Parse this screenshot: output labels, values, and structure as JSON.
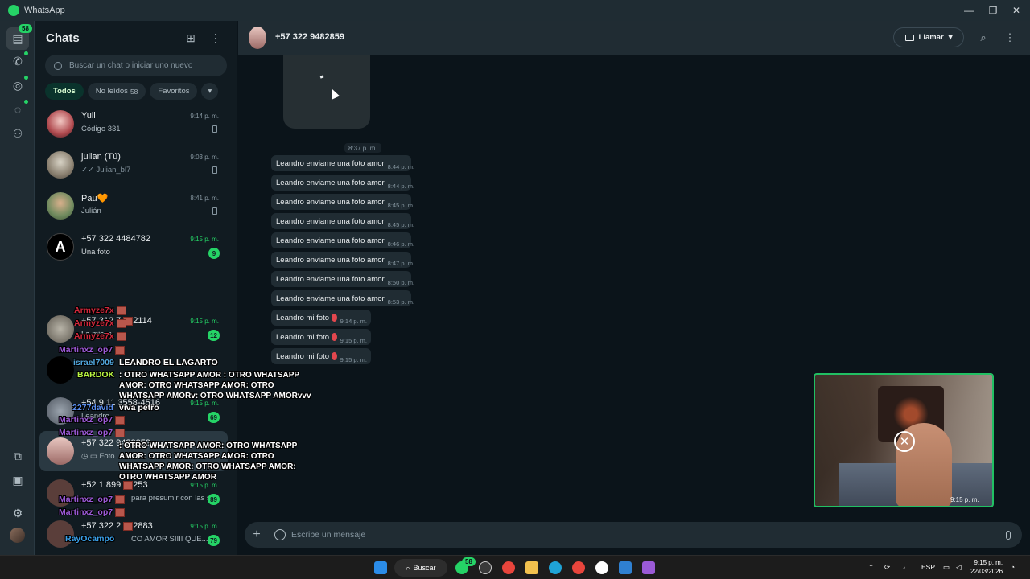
{
  "app": {
    "title": "WhatsApp"
  },
  "rail": {
    "chats_badge": "58"
  },
  "panel": {
    "title": "Chats",
    "search_placeholder": "Buscar un chat o iniciar uno nuevo",
    "filters": [
      {
        "label": "Todos",
        "count": ""
      },
      {
        "label": "No leídos",
        "count": "58"
      },
      {
        "label": "Favoritos",
        "count": ""
      }
    ],
    "filters_more": "▾"
  },
  "chats": [
    {
      "name": "Yuli",
      "preview": "Código 331",
      "time": "9:14 p. m.",
      "pinned": true
    },
    {
      "name": "julian (Tú)",
      "preview": "✓✓ Julian_bl7",
      "time": "9:03 p. m.",
      "pinned": true
    },
    {
      "name": "Pau🧡",
      "preview": "Julián",
      "time": "8:41 p. m.",
      "pinned": true
    },
    {
      "name": "+57 322 4484782",
      "preview": "Una foto",
      "time": "9:15 p. m.",
      "unread": "9"
    },
    {
      "name": "+57 312 7",
      "name_tail": "2114",
      "preview": "La missa",
      "time": "9:15 p. m.",
      "unread": "12"
    },
    {
      "name": "",
      "preview": "",
      "time": "",
      "unread": ""
    },
    {
      "name": "+54 9 11 3558-4516",
      "preview": "Leandro",
      "time": "9:15 p. m.",
      "unread": "69"
    },
    {
      "name": "+57 322 9482859",
      "preview": "Foto",
      "time": "",
      "unread": ""
    },
    {
      "name": "+52 1 899",
      "name_tail": "253",
      "preview": "para presumir con las s...",
      "time": "9:15 p. m.",
      "unread": "89"
    },
    {
      "name": "+57 322 2",
      "name_tail": "2883",
      "preview": "CO AMOR SIIII QUE...",
      "time": "9:15 p. m.",
      "unread": "79"
    }
  ],
  "header": {
    "name": "+57 322 9482859",
    "call_label": "Llamar"
  },
  "messages": {
    "date_stamp": "8:37 p. m.",
    "items": [
      {
        "text": "Leandro enviame una foto amor",
        "time": "8:44 p. m."
      },
      {
        "text": "Leandro enviame una foto amor",
        "time": "8:44 p. m."
      },
      {
        "text": "Leandro enviame una foto amor",
        "time": "8:45 p. m."
      },
      {
        "text": "Leandro enviame una foto amor",
        "time": "8:45 p. m."
      },
      {
        "text": "Leandro enviame una foto amor",
        "time": "8:46 p. m."
      },
      {
        "text": "Leandro enviame una foto amor",
        "time": "8:47 p. m."
      },
      {
        "text": "Leandro enviame una foto amor",
        "time": "8:50 p. m."
      },
      {
        "text": "Leandro enviame una foto amor",
        "time": "8:53 p. m."
      },
      {
        "text": "Leandro mi foto",
        "time": "9:14 p. m.",
        "emoji": "angry-face"
      },
      {
        "text": "Leandro mi foto",
        "time": "9:15 p. m.",
        "emoji": "angry-face"
      },
      {
        "text": "Leandro mi foto",
        "time": "9:15 p. m.",
        "emoji": "angry-face"
      }
    ]
  },
  "composer": {
    "placeholder": "Escribe un mensaje"
  },
  "camera": {
    "time": "9:15 p. m."
  },
  "stream_overlay": {
    "users": [
      {
        "name": "Armyze7x",
        "color": "#d2283c"
      },
      {
        "name": "Armyze7x",
        "color": "#d2283c"
      },
      {
        "name": "Armyze7x",
        "color": "#d2283c"
      },
      {
        "name": "Martinxz_op7",
        "color": "#9b59d6"
      },
      {
        "name": "israel7009",
        "color": "#52a9e0"
      },
      {
        "name": "BARDOK",
        "color": "#b9f542"
      },
      {
        "name": "2277david",
        "color": "#5b8ff0"
      },
      {
        "name": "Martinxz_op7",
        "color": "#9b59d6"
      },
      {
        "name": "Martinxz_op7",
        "color": "#9b59d6"
      },
      {
        "name": "Martinxz_op7",
        "color": "#9b59d6"
      },
      {
        "name": "Martinxz_op7",
        "color": "#9b59d6"
      },
      {
        "name": "RayOcampo",
        "color": "#3aa0e8"
      }
    ],
    "msg1_user": "LEANDRO EL LAGARTO",
    "msg1_text": ": OTRO WHATSAPP AMOR : OTRO WHATSAPP AMOR: OTRO WHATSAPP AMOR: OTRO WHATSAPP AMORv: OTRO WHATSAPP AMORvvv",
    "msg2_text": ": OTRO WHATSAPP AMOR: OTRO WHATSAPP AMOR: OTRO WHATSAPP AMOR: OTRO WHATSAPP AMOR: OTRO WHATSAPP AMOR: OTRO WHATSAPP AMOR",
    "viva": "viva petro"
  },
  "taskbar": {
    "search_label": "Buscar",
    "whatsapp_badge": "58",
    "lang": "ESP",
    "time": "9:15 p. m.",
    "date": "22/03/2026"
  },
  "colors": {
    "accent": "#25d366",
    "background": "#0b141a",
    "bubble": "#202c33"
  }
}
